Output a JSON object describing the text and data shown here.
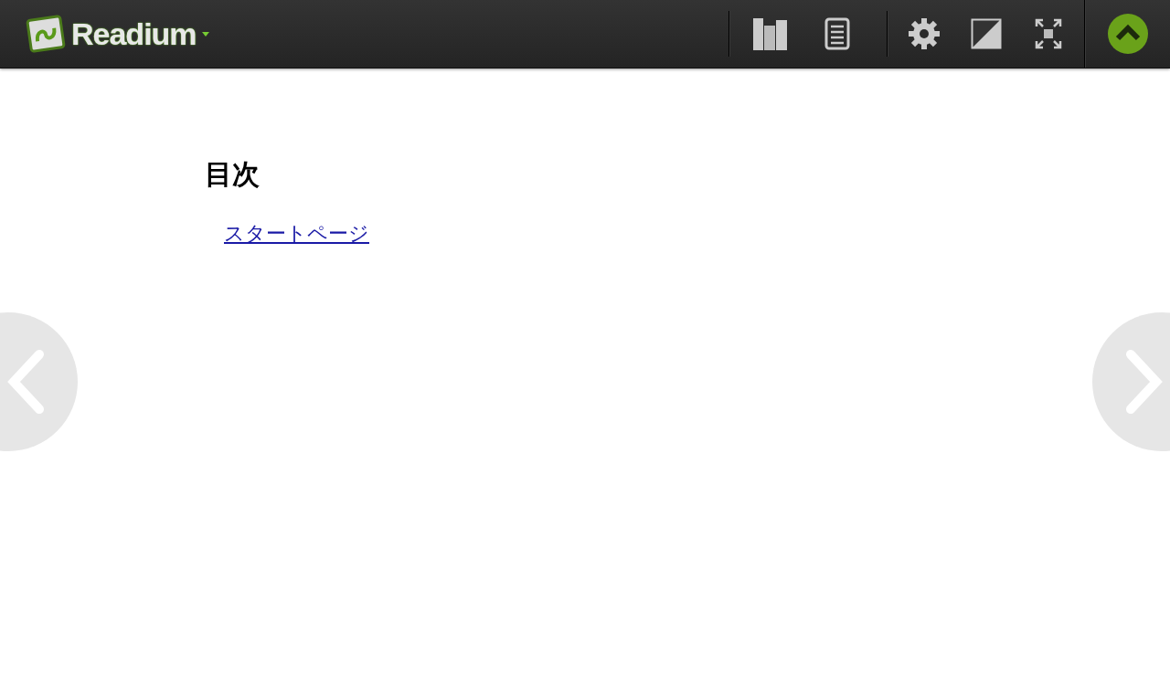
{
  "app": {
    "name": "Readium"
  },
  "content": {
    "heading": "目次",
    "links": [
      "スタートページ"
    ]
  }
}
